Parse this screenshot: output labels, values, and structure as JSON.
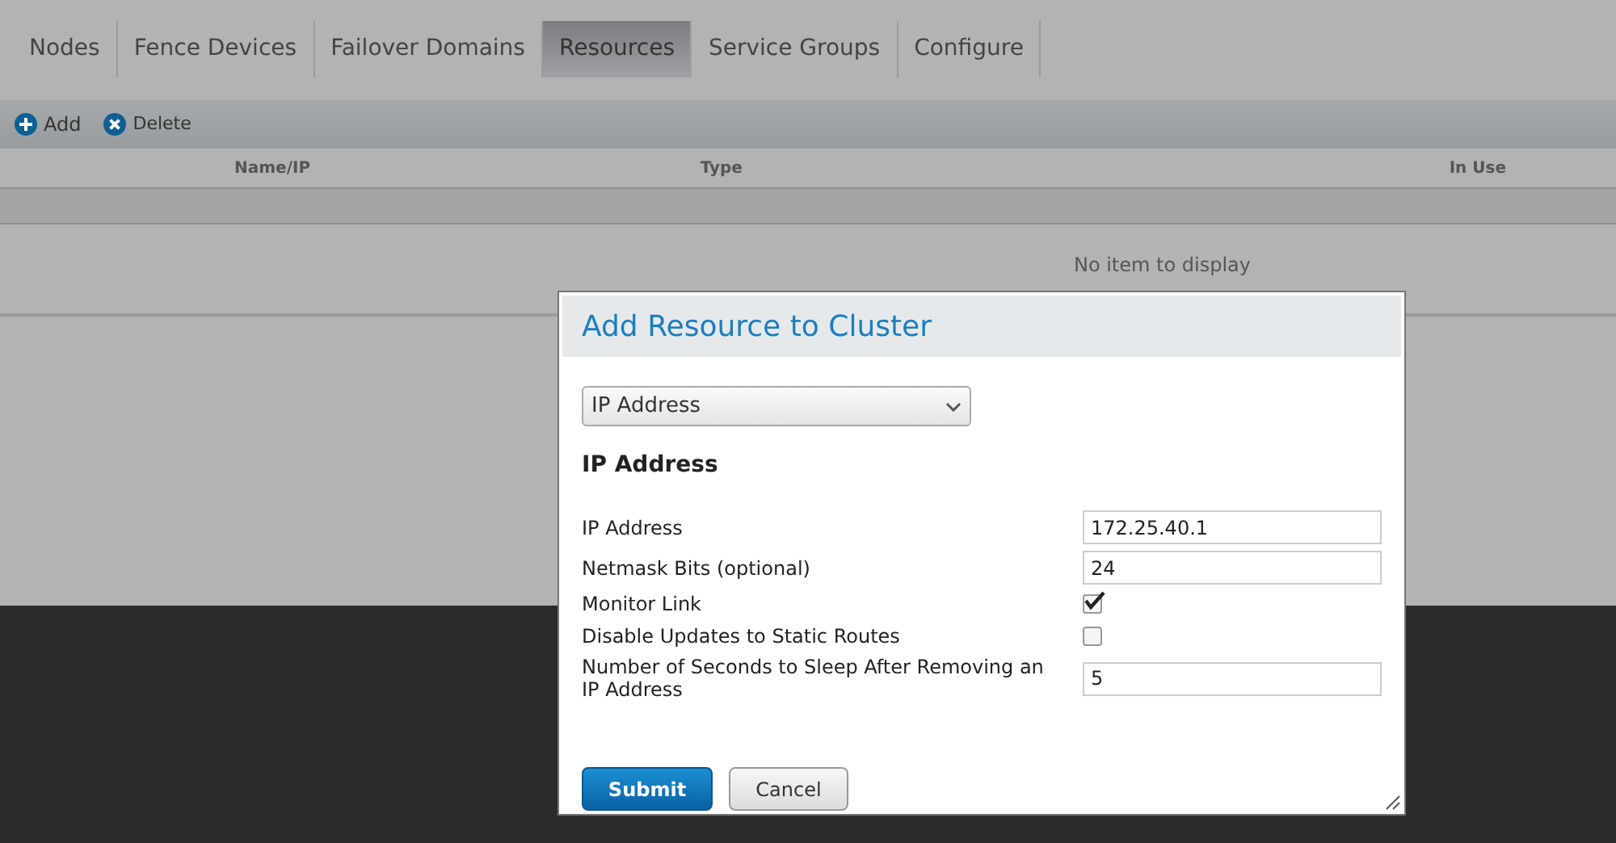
{
  "tabs": [
    {
      "label": "Nodes",
      "selected": false
    },
    {
      "label": "Fence Devices",
      "selected": false
    },
    {
      "label": "Failover Domains",
      "selected": false
    },
    {
      "label": "Resources",
      "selected": true
    },
    {
      "label": "Service Groups",
      "selected": false
    },
    {
      "label": "Configure",
      "selected": false
    }
  ],
  "toolbar": [
    {
      "label": "Add",
      "kind": "add"
    },
    {
      "label": "Delete",
      "kind": "delete"
    }
  ],
  "table": {
    "columns": [
      "Name/IP",
      "Type",
      "In Use"
    ],
    "empty_message": "No item to display"
  },
  "dialog": {
    "title": "Add Resource to Cluster",
    "resource_type": "IP Address",
    "section_title": "IP Address",
    "fields": [
      {
        "kind": "text",
        "label": "IP Address",
        "value": "172.25.40.1"
      },
      {
        "kind": "text",
        "label": "Netmask Bits (optional)",
        "value": "24"
      },
      {
        "kind": "checkbox",
        "label": "Monitor Link",
        "checked": true
      },
      {
        "kind": "checkbox",
        "label": "Disable Updates to Static Routes",
        "checked": false
      },
      {
        "kind": "text",
        "label": "Number of Seconds to Sleep After Removing an IP Address",
        "value": "5"
      }
    ],
    "buttons": [
      "Submit",
      "Cancel"
    ]
  }
}
